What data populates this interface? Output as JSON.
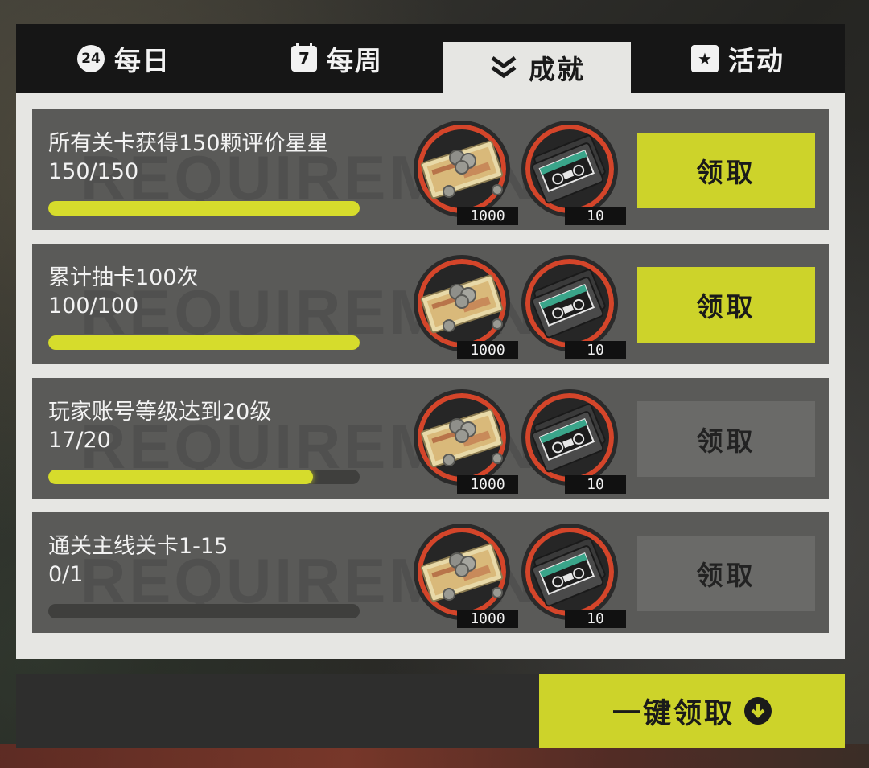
{
  "tabs": [
    {
      "label": "每日",
      "icon": "24",
      "icon_name": "day-24-icon"
    },
    {
      "label": "每周",
      "icon": "7",
      "icon_name": "calendar-7-icon"
    },
    {
      "label": "成就",
      "icon_name": "chevron-double-down-icon",
      "active": true
    },
    {
      "label": "活动",
      "icon": "★",
      "icon_name": "star-icon"
    }
  ],
  "watermark": "REQUIREMENT",
  "achievements": [
    {
      "title": "所有关卡获得150颗评价星星",
      "progress_text": "150/150",
      "progress": 1.0,
      "rewards": [
        {
          "icon_name": "cash-icon",
          "count": "1000"
        },
        {
          "icon_name": "cassette-ticket-icon",
          "count": "10"
        }
      ],
      "claim_label": "领取",
      "claimable": true
    },
    {
      "title": "累计抽卡100次",
      "progress_text": "100/100",
      "progress": 1.0,
      "rewards": [
        {
          "icon_name": "cash-icon",
          "count": "1000"
        },
        {
          "icon_name": "cassette-ticket-icon",
          "count": "10"
        }
      ],
      "claim_label": "领取",
      "claimable": true
    },
    {
      "title": "玩家账号等级达到20级",
      "progress_text": "17/20",
      "progress": 0.85,
      "rewards": [
        {
          "icon_name": "cash-icon",
          "count": "1000"
        },
        {
          "icon_name": "cassette-ticket-icon",
          "count": "10"
        }
      ],
      "claim_label": "领取",
      "claimable": false
    },
    {
      "title": "通关主线关卡1-15",
      "progress_text": "0/1",
      "progress": 0.0,
      "rewards": [
        {
          "icon_name": "cash-icon",
          "count": "1000"
        },
        {
          "icon_name": "cassette-ticket-icon",
          "count": "10"
        }
      ],
      "claim_label": "领取",
      "claimable": false
    }
  ],
  "claim_all_label": "一键领取",
  "colors": {
    "accent": "#cdd32a",
    "ring": "#d4452a",
    "row_bg": "#5a5a58",
    "tab_bg": "#161616"
  }
}
